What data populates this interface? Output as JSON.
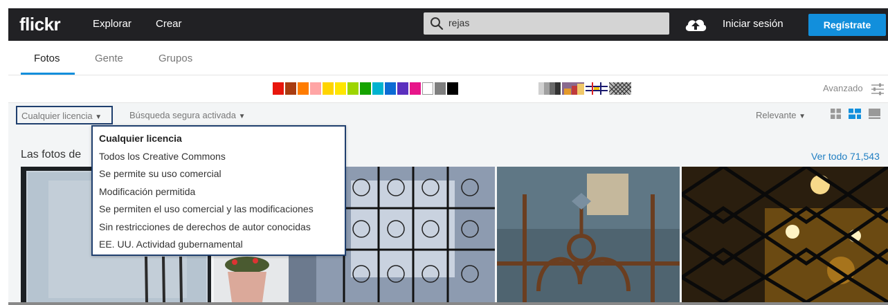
{
  "header": {
    "logo": "flickr",
    "nav": [
      "Explorar",
      "Crear"
    ],
    "search_value": "rejas",
    "login_label": "Iniciar sesión",
    "signup_label": "Regístrate"
  },
  "tabs": [
    "Fotos",
    "Gente",
    "Grupos"
  ],
  "colors": {
    "swatches": [
      "#e8160c",
      "#a83c11",
      "#ff7c00",
      "#ffa5a5",
      "#ffd400",
      "#ffe600",
      "#9dd500",
      "#16a300",
      "#00b3d0",
      "#0c6bd4",
      "#5b2fbe",
      "#e7168a",
      "#ffffff",
      "#7f7f7f",
      "#000000"
    ],
    "accent": "#128fdc",
    "focus_border": "#1f3f6e"
  },
  "filters": {
    "advanced_label": "Avanzado",
    "license_label": "Cualquier licencia",
    "safe_search_label": "Búsqueda segura activada",
    "sort_label": "Relevante"
  },
  "license_menu": [
    "Cualquier licencia",
    "Todos los Creative Commons",
    "Se permite su uso comercial",
    "Modificación permitida",
    "Se permiten el uso comercial y las modificaciones",
    "Sin restricciones de derechos de autor conocidas",
    "EE. UU. Actividad gubernamental"
  ],
  "results": {
    "title": "Las fotos de",
    "see_all": "Ver todo 71,543"
  }
}
